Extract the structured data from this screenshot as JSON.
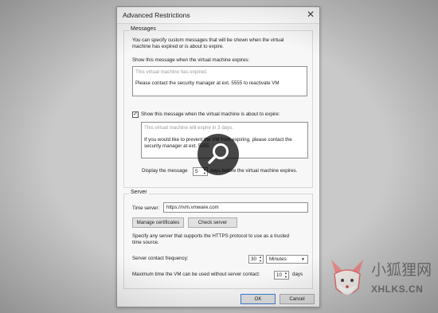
{
  "dialog": {
    "title": "Advanced Restrictions",
    "close_glyph": "✕"
  },
  "messages": {
    "group_label": "Messages",
    "description_line1": "You can specify custom messages that will be shown when the virtual",
    "description_line2": "machine has expired or is about to expire.",
    "expired_label": "Show this message when the virtual machine expires:",
    "expired_placeholder": "This virtual machine has expired.",
    "expired_text": "Please contact the security manager at ext. 5555 to reactivate VM",
    "about_checked": true,
    "about_label": "Show this message when the virtual machine is about to expire:",
    "about_placeholder": "This virtual machine will expire in 3 days.",
    "about_text_line1": "If you would like to prevent the VM from expiring, please contact the",
    "about_text_line2": "security manager at ext. 5555",
    "display_prefix": "Display the message",
    "display_days": "5",
    "display_suffix": "days before the virtual machine expires."
  },
  "server": {
    "group_label": "Server",
    "time_server_label": "Time server:",
    "time_server_value": "https://rvm.vmware.com",
    "manage_certificates_button": "Manage certificates",
    "check_server_button": "Check server",
    "note_line1": "Specify any server that supports the HTTPS protocol to use as a trusted",
    "note_line2": "time source.",
    "frequency_label": "Server contact frequency:",
    "frequency_value": "30",
    "frequency_unit": "Minutes",
    "max_time_label": "Maximum time the VM can be used without server contact:",
    "max_time_value": "10",
    "max_time_unit": "days"
  },
  "footer": {
    "ok_button": "OK",
    "cancel_button": "Cancel"
  },
  "watermark": {
    "cn_text": "小狐狸网",
    "en_text": "XHLKS.CN"
  },
  "icons": {
    "zoom": "magnifier-icon",
    "watermark": "fox-logo-icon"
  }
}
